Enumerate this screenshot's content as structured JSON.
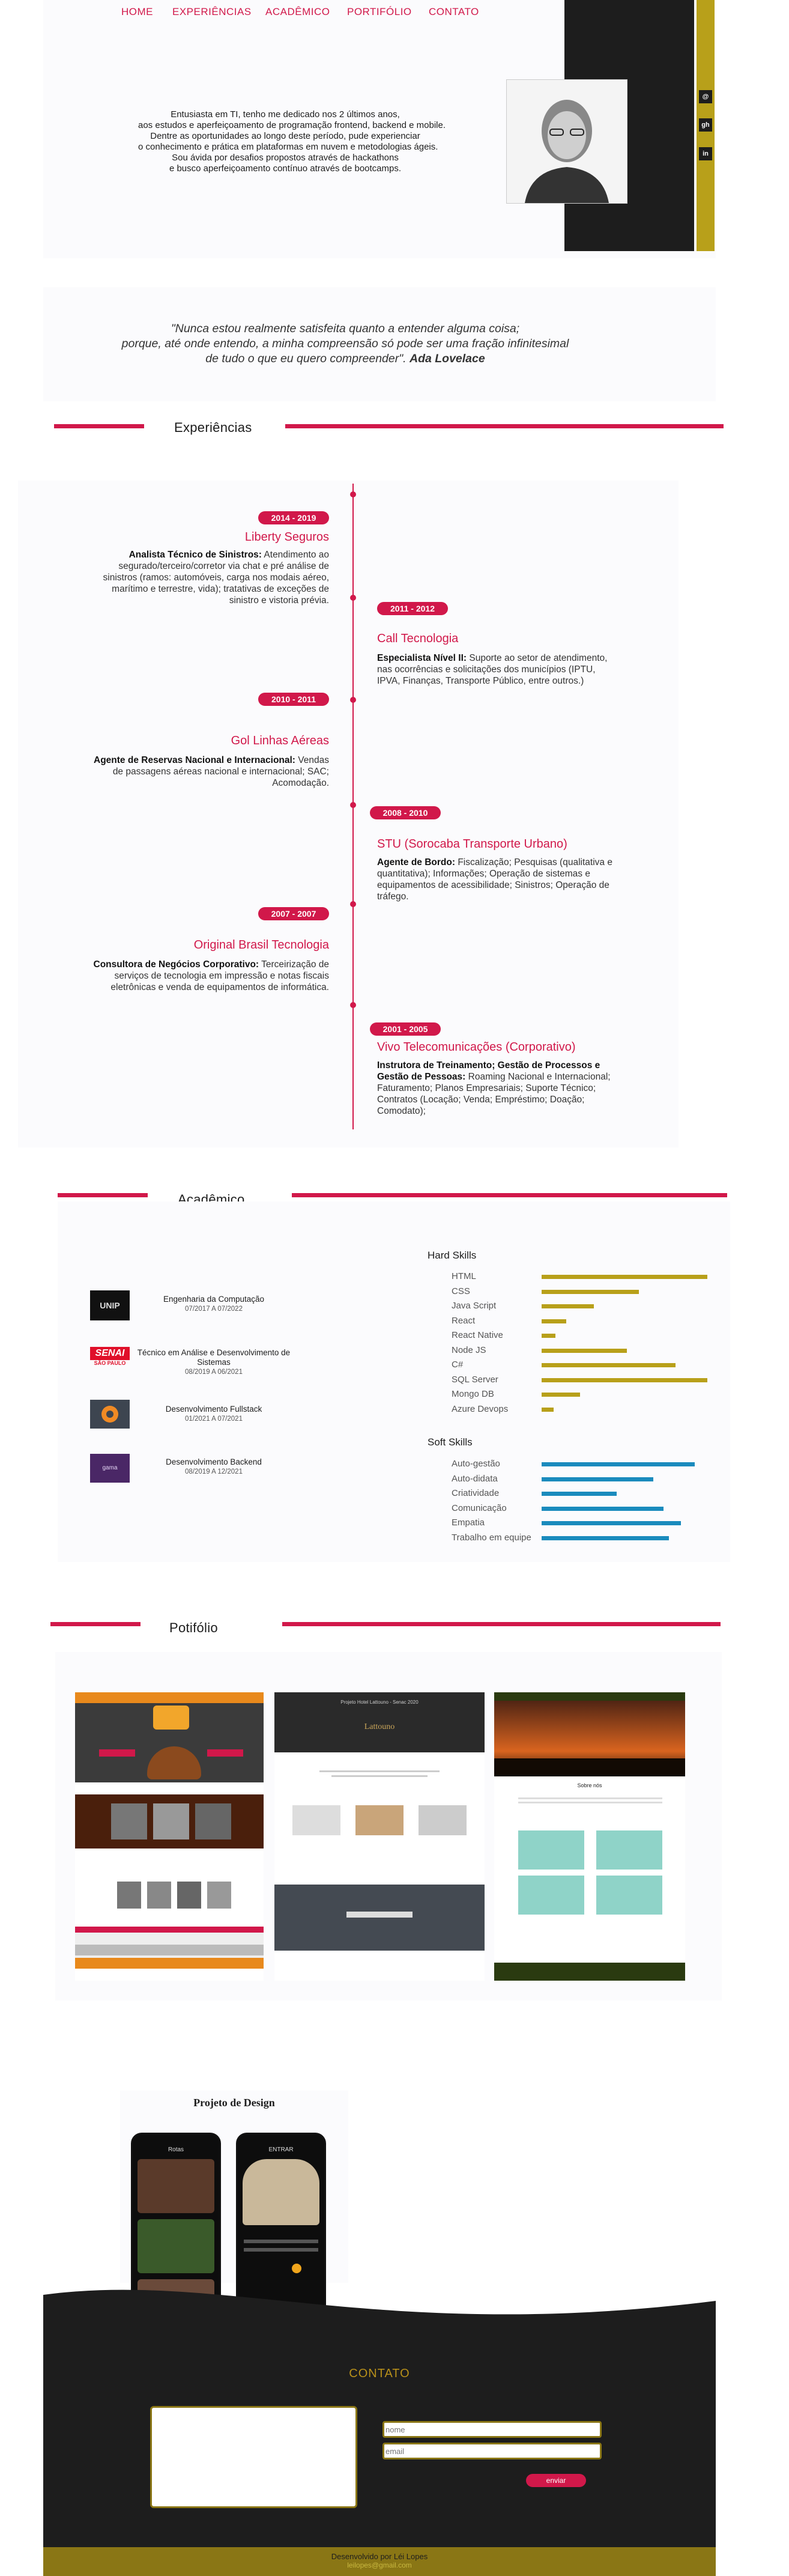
{
  "nav": [
    "HOME",
    "EXPERIÊNCIAS",
    "ACADÊMICO",
    "PORTIFÓLIO",
    "CONTATO"
  ],
  "social": [
    "@",
    "gh",
    "in"
  ],
  "intro": [
    "Entusiasta em TI, tenho me dedicado nos 2 últimos anos,",
    "aos estudos e aperfeiçoamento de programação frontend, backend e mobile.",
    "Dentre as oportunidades ao longo deste período, pude experienciar",
    "o conhecimento e prática em plataformas em nuvem e metodologias ágeis.",
    "Sou ávida por desafios propostos através de hackathons",
    "e busco aperfeiçoamento contínuo através de bootcamps."
  ],
  "quote": {
    "line1": "\"Nunca estou realmente satisfeita quanto a entender alguma coisa;",
    "line2": "porque, até onde entendo, a minha compreensão só pode ser uma fração infinitesimal",
    "line3": "de tudo o que eu quero compreender\".",
    "author": "Ada Lovelace"
  },
  "experiences": {
    "title": "Experiências",
    "items": [
      {
        "period": "2014 - 2019",
        "company": "Liberty Seguros",
        "role": "Analista Técnico de Sinistros:",
        "text": "Atendimento ao segurado/terceiro/corretor via chat e pré análise de sinistros (ramos: automóveis, carga nos modais aéreo, marítimo e terrestre, vida); tratativas de exceções de sinistro e vistoria prévia."
      },
      {
        "period": "2011 - 2012",
        "company": "Call Tecnologia",
        "role": "Especialista Nível II:",
        "text": "Suporte ao setor de atendimento, nas ocorrências e solicitações dos municípios (IPTU, IPVA, Finanças, Transporte Público, entre outros.)"
      },
      {
        "period": "2010 - 2011",
        "company": "Gol Linhas Aéreas",
        "role": "Agente de Reservas Nacional e Internacional:",
        "text": "Vendas de passagens aéreas nacional e internacional; SAC; Acomodação."
      },
      {
        "period": "2008 - 2010",
        "company": "STU (Sorocaba Transporte Urbano)",
        "role": "Agente de Bordo:",
        "text": "Fiscalização; Pesquisas (qualitativa e quantitativa); Informações; Operação de sistemas e equipamentos de acessibilidade; Sinistros; Operação de tráfego."
      },
      {
        "period": "2007 - 2007",
        "company": "Original Brasil Tecnologia",
        "role": "Consultora de Negócios Corporativo:",
        "text": "Terceirização de serviços de tecnologia em impressão e notas fiscais eletrônicas e venda de equipamentos de informática."
      },
      {
        "period": "2001 - 2005",
        "company": "Vivo Telecomunicações (Corporativo)",
        "role": "Instrutora de Treinamento; Gestão de Processos e Gestão de Pessoas:",
        "text": "Roaming Nacional e Internacional; Faturamento; Planos Empresariais; Suporte Técnico; Contratos (Locação; Venda; Empréstimo; Doação; Comodato);"
      }
    ]
  },
  "academic": {
    "title": "Acadêmico",
    "courses": [
      {
        "logo": "UNIP",
        "name": "Engenharia da Computação",
        "dates": "07/2017 A 07/2022"
      },
      {
        "logo": "SENAI",
        "logo_sub": "SÃO PAULO",
        "name": "Técnico em Análise e Desenvolvimento de Sistemas",
        "dates": "08/2019 A 06/2021"
      },
      {
        "logo": "",
        "name": "Desenvolvimento Fullstack",
        "dates": "01/2021 A 07/2021"
      },
      {
        "logo": "gama",
        "name": "Desenvolvimento Backend",
        "dates": "08/2019 A 12/2021"
      }
    ],
    "hard_title": "Hard Skills",
    "hard": [
      {
        "name": "HTML",
        "level": 0.95
      },
      {
        "name": "CSS",
        "level": 0.56
      },
      {
        "name": "Java Script",
        "level": 0.3
      },
      {
        "name": "React",
        "level": 0.14
      },
      {
        "name": "React Native",
        "level": 0.08
      },
      {
        "name": "Node JS",
        "level": 0.49
      },
      {
        "name": "C#",
        "level": 0.77
      },
      {
        "name": "SQL Server",
        "level": 0.95
      },
      {
        "name": "Mongo DB",
        "level": 0.22
      },
      {
        "name": "Azure Devops",
        "level": 0.07
      }
    ],
    "soft_title": "Soft Skills",
    "soft": [
      {
        "name": "Auto-gestão",
        "level": 0.88
      },
      {
        "name": "Auto-didata",
        "level": 0.64
      },
      {
        "name": "Criatividade",
        "level": 0.43
      },
      {
        "name": "Comunicação",
        "level": 0.7
      },
      {
        "name": "Empatia",
        "level": 0.8
      },
      {
        "name": "Trabalho em equipe",
        "level": 0.73
      }
    ],
    "hard_color": "#b8a01a",
    "soft_color": "#1a8bbd"
  },
  "portfolio": {
    "title": "Potifólio",
    "design_title": "Projeto de Design",
    "shot2_header": "Projeto Hotel Lattouno - Senac 2020",
    "shot2_brand": "Lattouno",
    "shot3_title": "Sobre nós",
    "app1_header": "Rotas",
    "app2_header": "ENTRAR"
  },
  "contact": {
    "title": "CONTATO",
    "name_ph": "nome",
    "email_ph": "email",
    "send": "enviar",
    "footer": "Desenvolvido por Léi Lopes",
    "footer_sub": "leilopes@gmail.com"
  }
}
